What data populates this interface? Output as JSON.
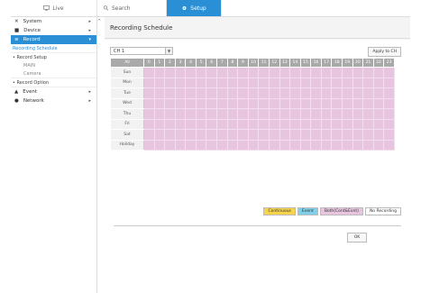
{
  "nav": {
    "live_label": "Live",
    "search_label": "Search",
    "setup_label": "Setup"
  },
  "sidebar": {
    "system_label": "System",
    "device_label": "Device",
    "record_label": "Record",
    "recording_schedule_label": "Recording Schedule",
    "record_setup_label": "Record Setup",
    "main_label": "MAIN",
    "camera_label": "Camera",
    "record_option_label": "Record Option",
    "event_label": "Event",
    "network_label": "Network"
  },
  "page": {
    "title": "Recording Schedule",
    "channel_value": "CH 1",
    "apply_label": "Apply to CH",
    "all_label": "All",
    "hours": [
      "0",
      "1",
      "2",
      "3",
      "4",
      "5",
      "6",
      "7",
      "8",
      "9",
      "10",
      "11",
      "12",
      "13",
      "14",
      "15",
      "16",
      "17",
      "18",
      "19",
      "20",
      "21",
      "22",
      "23"
    ],
    "days": [
      "Sun",
      "Mon",
      "Tue",
      "Wed",
      "Thu",
      "Fri",
      "Sat",
      "Holiday"
    ],
    "ok_label": "OK"
  },
  "legend": {
    "continuous": "Continuous",
    "event": "Event",
    "both": "Both(Cont&Evnt)",
    "none": "No Recording"
  },
  "colors": {
    "accent": "#2a8fd4",
    "cell": "#e7c5df",
    "continuous": "#f5d34a",
    "event": "#7fd0e8",
    "both": "#e7c5df",
    "none": "#ffffff"
  }
}
